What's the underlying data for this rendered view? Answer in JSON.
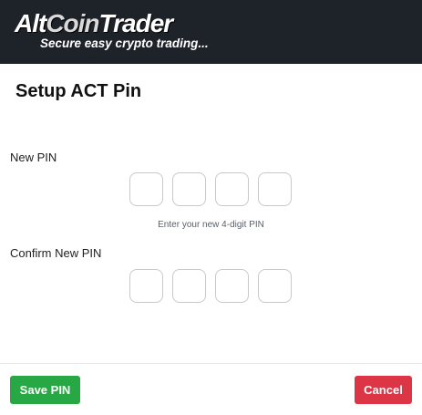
{
  "header": {
    "logo_part1": "Alt",
    "logo_part2": "Coin",
    "logo_part3": "Trader",
    "tagline": "Secure easy crypto trading..."
  },
  "dialog": {
    "title": "Setup ACT Pin",
    "new_pin_label": "New PIN",
    "new_pin_helper": "Enter your new 4-digit PIN",
    "confirm_pin_label": "Confirm New PIN",
    "new_pin_digits": [
      "",
      "",
      "",
      ""
    ],
    "confirm_pin_digits": [
      "",
      "",
      "",
      ""
    ]
  },
  "footer": {
    "save_label": "Save PIN",
    "cancel_label": "Cancel"
  },
  "colors": {
    "header_bg": "#1e2229",
    "save_green": "#28a745",
    "cancel_red": "#dc3545"
  }
}
